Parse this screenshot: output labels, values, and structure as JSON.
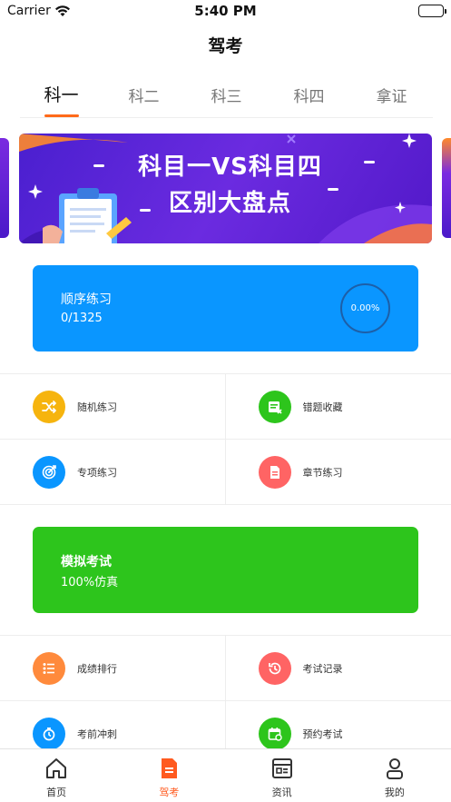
{
  "status_bar": {
    "carrier": "Carrier",
    "time": "5:40 PM"
  },
  "nav": {
    "title": "驾考"
  },
  "subject_tabs": [
    {
      "label": "科一",
      "active": true
    },
    {
      "label": "科二",
      "active": false
    },
    {
      "label": "科三",
      "active": false
    },
    {
      "label": "科四",
      "active": false
    },
    {
      "label": "拿证",
      "active": false
    }
  ],
  "banner": {
    "line1": "科目一VS科目四",
    "line2": "区别大盘点"
  },
  "order_practice": {
    "title": "顺序练习",
    "count": "0/1325",
    "progress": "0.00%"
  },
  "practice_grid": [
    {
      "label": "随机练习",
      "icon": "shuffle-icon",
      "color": "#f6b40e"
    },
    {
      "label": "错题收藏",
      "icon": "wrong-book-icon",
      "color": "#2dc51c"
    },
    {
      "label": "专项练习",
      "icon": "target-icon",
      "color": "#0a96ff"
    },
    {
      "label": "章节练习",
      "icon": "document-icon",
      "color": "#ff6464"
    }
  ],
  "mock_exam": {
    "title": "模拟考试",
    "subtitle": "100%仿真"
  },
  "exam_grid": [
    {
      "label": "成绩排行",
      "icon": "ranking-list-icon",
      "color": "#ff8a3c"
    },
    {
      "label": "考试记录",
      "icon": "history-icon",
      "color": "#ff6464"
    },
    {
      "label": "考前冲刺",
      "icon": "stopwatch-icon",
      "color": "#0a96ff"
    },
    {
      "label": "预约考试",
      "icon": "calendar-icon",
      "color": "#2dc51c"
    }
  ],
  "tabbar": [
    {
      "label": "首页",
      "icon": "home-icon",
      "active": false
    },
    {
      "label": "驾考",
      "icon": "exam-document-icon",
      "active": true
    },
    {
      "label": "资讯",
      "icon": "news-icon",
      "active": false
    },
    {
      "label": "我的",
      "icon": "user-icon",
      "active": false
    }
  ],
  "colors": {
    "accent": "#ff6a1a",
    "order_card": "#0a96ff",
    "exam_card": "#2dc51c"
  }
}
